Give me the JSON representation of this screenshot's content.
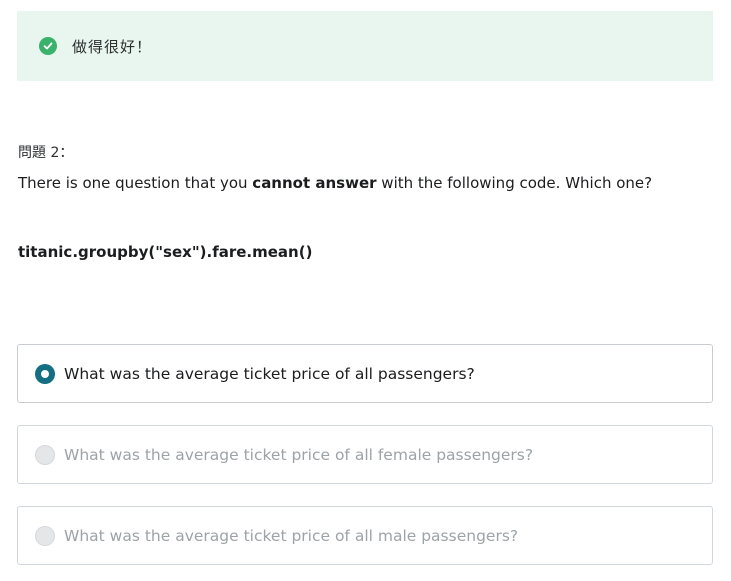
{
  "banner": {
    "message": "做得很好！",
    "icon": "check-circle-icon",
    "color": "#3ab26b",
    "background": "#e9f6ef"
  },
  "question": {
    "number_label": "問題 2：",
    "text_before": "There is one question that you ",
    "text_bold": "cannot answer",
    "text_after": " with the following code. Which one?",
    "code": "titanic.groupby(\"sex\").fare.mean()"
  },
  "options": [
    {
      "label": "What was the average ticket price of all passengers?",
      "selected": true
    },
    {
      "label": "What was the average ticket price of all female passengers?",
      "selected": false
    },
    {
      "label": "What was the average ticket price of all male passengers?",
      "selected": false
    }
  ],
  "colors": {
    "accent": "#156f82",
    "disabled_text": "#9da3a7"
  }
}
